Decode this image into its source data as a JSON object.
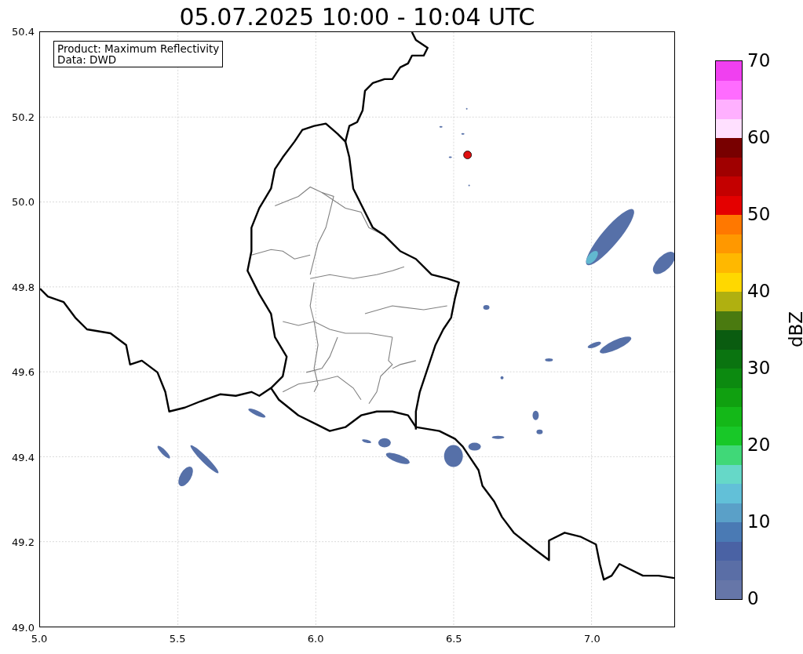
{
  "title": "05.07.2025 10:00 - 10:04 UTC",
  "info_box": {
    "lines": [
      "Product: Maximum Reflectivity",
      "Data: DWD"
    ]
  },
  "y_axis": {
    "ticks": [
      "50.4",
      "50.2",
      "50.0",
      "49.8",
      "49.6",
      "49.4",
      "49.2",
      "49.0"
    ]
  },
  "x_axis": {
    "ticks": [
      "5.0",
      "5.5",
      "6.0",
      "6.5",
      "7.0"
    ]
  },
  "colorbar": {
    "label": "dBZ",
    "ticks": [
      "70",
      "60",
      "50",
      "40",
      "30",
      "20",
      "10",
      "0"
    ],
    "steps": [
      {
        "color": "#f040f0"
      },
      {
        "color": "#ff6cff"
      },
      {
        "color": "#ffb0ff"
      },
      {
        "color": "#ffe0ff"
      },
      {
        "color": "#780000"
      },
      {
        "color": "#a00000"
      },
      {
        "color": "#c40000"
      },
      {
        "color": "#e40000"
      },
      {
        "color": "#ff7800"
      },
      {
        "color": "#ff9800"
      },
      {
        "color": "#ffb800"
      },
      {
        "color": "#ffd800"
      },
      {
        "color": "#b0b010"
      },
      {
        "color": "#4a7a10"
      },
      {
        "color": "#0a5c10"
      },
      {
        "color": "#0a7410"
      },
      {
        "color": "#0c8a10"
      },
      {
        "color": "#10a010"
      },
      {
        "color": "#14b818"
      },
      {
        "color": "#18c828"
      },
      {
        "color": "#40d878"
      },
      {
        "color": "#66d8c8"
      },
      {
        "color": "#62c0d8"
      },
      {
        "color": "#5aa0c8"
      },
      {
        "color": "#4a7ab4"
      },
      {
        "color": "#4a62a4"
      },
      {
        "color": "#5a6ea6"
      },
      {
        "color": "#6676a8"
      }
    ]
  }
}
